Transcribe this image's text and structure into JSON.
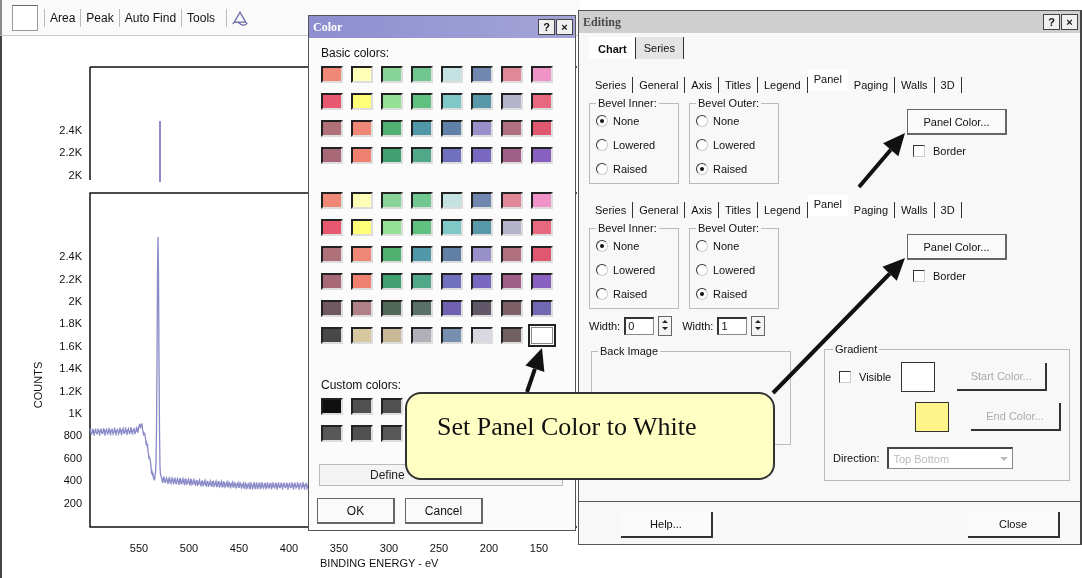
{
  "app": {
    "toolbar": [
      {
        "kind": "blank"
      },
      {
        "kind": "label",
        "label": "Area"
      },
      {
        "kind": "label",
        "label": "Peak"
      },
      {
        "kind": "label",
        "label": "Auto Find"
      },
      {
        "kind": "label",
        "label": "Tools"
      },
      {
        "kind": "icon"
      }
    ],
    "plot": {
      "top_panel": {
        "y_ticks": [
          "2.4K",
          "2.2K",
          "2K"
        ]
      },
      "main_panel": {
        "y_label": "COUNTS",
        "y_ticks": [
          "2.4K",
          "2.2K",
          "2K",
          "1.8K",
          "1.6K",
          "1.4K",
          "1.2K",
          "1K",
          "800",
          "600",
          "400",
          "200"
        ],
        "x_ticks": [
          "550",
          "500",
          "450",
          "400",
          "350",
          "300",
          "250",
          "200",
          "150"
        ],
        "x_label": "BINDING ENERGY - eV"
      }
    }
  },
  "color_dialog": {
    "title": "Color",
    "title_buttons": [
      "?",
      "×"
    ],
    "basic_label": "Basic colors:",
    "basic_colors_top": [
      [
        {
          "color": "#f08878",
          "selected": false
        },
        {
          "color": "#ffffb8",
          "selected": false
        },
        {
          "color": "#88d498",
          "selected": false
        },
        {
          "color": "#70c890",
          "selected": false
        },
        {
          "color": "#c4e2e2",
          "selected": false
        },
        {
          "color": "#7088b0",
          "selected": false
        },
        {
          "color": "#e08898",
          "selected": false
        },
        {
          "color": "#f094c8",
          "selected": false
        }
      ],
      [
        {
          "color": "#e85870",
          "selected": false
        },
        {
          "color": "#ffff78",
          "selected": false
        },
        {
          "color": "#94e094",
          "selected": false
        },
        {
          "color": "#60c080",
          "selected": false
        },
        {
          "color": "#80c8c8",
          "selected": false
        },
        {
          "color": "#5898a8",
          "selected": false
        },
        {
          "color": "#b4b4cc",
          "selected": false
        },
        {
          "color": "#e86880",
          "selected": false
        }
      ],
      [
        {
          "color": "#b07078",
          "selected": false
        },
        {
          "color": "#f08878",
          "selected": false
        },
        {
          "color": "#50b070",
          "selected": false
        },
        {
          "color": "#5098a8",
          "selected": false
        },
        {
          "color": "#6080a8",
          "selected": false
        },
        {
          "color": "#9890c8",
          "selected": false
        },
        {
          "color": "#b07080",
          "selected": false
        },
        {
          "color": "#e05870",
          "selected": false
        }
      ],
      [
        {
          "color": "#a86878",
          "selected": false
        },
        {
          "color": "#f08070",
          "selected": false
        },
        {
          "color": "#40a070",
          "selected": false
        },
        {
          "color": "#50a888",
          "selected": false
        },
        {
          "color": "#7070c0",
          "selected": false
        },
        {
          "color": "#7868c0",
          "selected": false
        },
        {
          "color": "#a06088",
          "selected": false
        },
        {
          "color": "#8860c0",
          "selected": false
        }
      ]
    ],
    "basic_colors": [
      [
        {
          "color": "#f08878",
          "selected": false
        },
        {
          "color": "#ffffb8",
          "selected": false
        },
        {
          "color": "#88d498",
          "selected": false
        },
        {
          "color": "#70c890",
          "selected": false
        },
        {
          "color": "#c4e2e2",
          "selected": false
        },
        {
          "color": "#7088b0",
          "selected": false
        },
        {
          "color": "#e08898",
          "selected": false
        },
        {
          "color": "#f094c8",
          "selected": false
        }
      ],
      [
        {
          "color": "#e85870",
          "selected": false
        },
        {
          "color": "#ffff78",
          "selected": false
        },
        {
          "color": "#94e094",
          "selected": false
        },
        {
          "color": "#60c080",
          "selected": false
        },
        {
          "color": "#80c8c8",
          "selected": false
        },
        {
          "color": "#5898a8",
          "selected": false
        },
        {
          "color": "#b4b4cc",
          "selected": false
        },
        {
          "color": "#e86880",
          "selected": false
        }
      ],
      [
        {
          "color": "#b07078",
          "selected": false
        },
        {
          "color": "#f08878",
          "selected": false
        },
        {
          "color": "#50b070",
          "selected": false
        },
        {
          "color": "#5098a8",
          "selected": false
        },
        {
          "color": "#6080a8",
          "selected": false
        },
        {
          "color": "#9890c8",
          "selected": false
        },
        {
          "color": "#b07080",
          "selected": false
        },
        {
          "color": "#e05870",
          "selected": false
        }
      ],
      [
        {
          "color": "#a86878",
          "selected": false
        },
        {
          "color": "#f08070",
          "selected": false
        },
        {
          "color": "#40a070",
          "selected": false
        },
        {
          "color": "#50a888",
          "selected": false
        },
        {
          "color": "#7070c0",
          "selected": false
        },
        {
          "color": "#7868c0",
          "selected": false
        },
        {
          "color": "#a06088",
          "selected": false
        },
        {
          "color": "#8860c0",
          "selected": false
        }
      ],
      [
        {
          "color": "#705860",
          "selected": false
        },
        {
          "color": "#b08088",
          "selected": false
        },
        {
          "color": "#506858",
          "selected": false
        },
        {
          "color": "#587068",
          "selected": false
        },
        {
          "color": "#7060b0",
          "selected": false
        },
        {
          "color": "#605868",
          "selected": false
        },
        {
          "color": "#806068",
          "selected": false
        },
        {
          "color": "#7068b0",
          "selected": false
        }
      ],
      [
        {
          "color": "#484848",
          "selected": false
        },
        {
          "color": "#d8c8a0",
          "selected": false
        },
        {
          "color": "#c8b898",
          "selected": false
        },
        {
          "color": "#b0b0b8",
          "selected": false
        },
        {
          "color": "#7890b0",
          "selected": false
        },
        {
          "color": "#d8d8e0",
          "selected": false
        },
        {
          "color": "#706060",
          "selected": false
        },
        {
          "color": "#ffffff",
          "selected": true
        }
      ]
    ],
    "custom_label": "Custom colors:",
    "custom_colors": [
      [
        {
          "color": "#101010"
        },
        {
          "color": "#505050"
        },
        {
          "color": "#505050"
        }
      ],
      [
        {
          "color": "#585858"
        },
        {
          "color": "#505050"
        },
        {
          "color": "#585858"
        }
      ]
    ],
    "define_button": "Define",
    "buttons": [
      "OK",
      "Cancel"
    ]
  },
  "editing": {
    "title": "Editing",
    "title_buttons": [
      "?",
      "×"
    ],
    "tabs": [
      {
        "label": "Chart",
        "selected": true
      },
      {
        "label": "Series",
        "selected": false
      }
    ],
    "panels": [
      {
        "subtabs": [
          {
            "label": "Series",
            "selected": false
          },
          {
            "label": "General",
            "selected": false
          },
          {
            "label": "Axis",
            "selected": false
          },
          {
            "label": "Titles",
            "selected": false
          },
          {
            "label": "Legend",
            "selected": false
          },
          {
            "label": "Panel",
            "selected": true
          },
          {
            "label": "Paging",
            "selected": false
          },
          {
            "label": "Walls",
            "selected": false
          },
          {
            "label": "3D",
            "selected": false
          }
        ],
        "bevel_inner": {
          "label": "Bevel Inner:",
          "options": [
            {
              "label": "None",
              "selected": true
            },
            {
              "label": "Lowered",
              "selected": false
            },
            {
              "label": "Raised",
              "selected": false
            }
          ]
        },
        "bevel_outer": {
          "label": "Bevel Outer:",
          "options": [
            {
              "label": "None",
              "selected": false
            },
            {
              "label": "Lowered",
              "selected": false
            },
            {
              "label": "Raised",
              "selected": true
            }
          ]
        },
        "panel_color_button": "Panel Color...",
        "border": {
          "label": "Border",
          "checked": false
        }
      },
      {
        "subtabs": [
          {
            "label": "Series",
            "selected": false
          },
          {
            "label": "General",
            "selected": false
          },
          {
            "label": "Axis",
            "selected": false
          },
          {
            "label": "Titles",
            "selected": false
          },
          {
            "label": "Legend",
            "selected": false
          },
          {
            "label": "Panel",
            "selected": true
          },
          {
            "label": "Paging",
            "selected": false
          },
          {
            "label": "Walls",
            "selected": false
          },
          {
            "label": "3D",
            "selected": false
          }
        ],
        "bevel_inner": {
          "label": "Bevel Inner:",
          "options": [
            {
              "label": "None",
              "selected": true
            },
            {
              "label": "Lowered",
              "selected": false
            },
            {
              "label": "Raised",
              "selected": false
            }
          ]
        },
        "bevel_outer": {
          "label": "Bevel Outer:",
          "options": [
            {
              "label": "None",
              "selected": false
            },
            {
              "label": "Lowered",
              "selected": false
            },
            {
              "label": "Raised",
              "selected": true
            }
          ]
        },
        "panel_color_button": "Panel Color...",
        "border": {
          "label": "Border",
          "checked": false
        },
        "extras": {
          "width_fields": [
            {
              "label": "Width:",
              "value": "0"
            },
            {
              "label": "Width:",
              "value": "1"
            }
          ],
          "back_image": {
            "label": "Back Image"
          },
          "gradient": {
            "label": "Gradient",
            "visible": {
              "label": "Visible",
              "checked": false
            },
            "colors": [
              {
                "color": "#ffffff",
                "button": "Start Color...",
                "disabled": true
              },
              {
                "color": "#fff48a",
                "button": "End Color...",
                "disabled": true
              }
            ],
            "direction": {
              "label": "Direction:",
              "value": "Top Bottom",
              "disabled": true
            }
          }
        }
      }
    ],
    "buttons": [
      "Help...",
      "Close"
    ]
  },
  "callout": {
    "text": "Set Panel Color to White"
  }
}
